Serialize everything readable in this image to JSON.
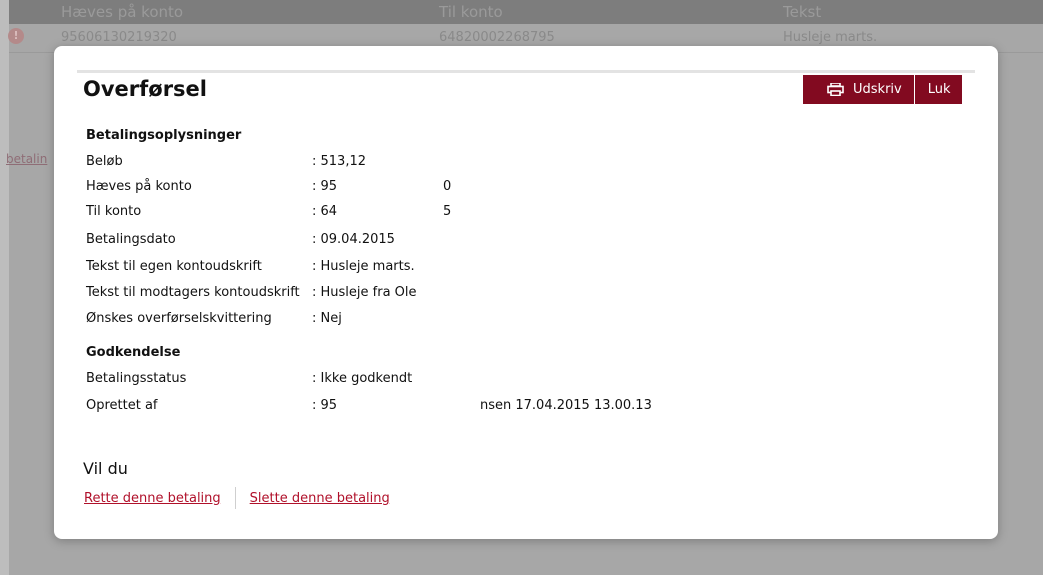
{
  "background": {
    "header_columns": [
      "Hæves på konto",
      "Til konto",
      "Tekst"
    ],
    "row": {
      "from_account": "95606130219320",
      "to_account": "64820002268795",
      "text": "Husleje marts."
    },
    "partial_link": "betalin"
  },
  "modal": {
    "title": "Overførsel",
    "print_label": "Udskriv",
    "close_label": "Luk",
    "payment_section": {
      "title": "Betalingsoplysninger",
      "rows": [
        {
          "label": "Beløb",
          "value": ": 513,12"
        },
        {
          "label": "Hæves på konto",
          "value": ": 95",
          "value_extra": "0"
        },
        {
          "label": "Til konto",
          "value": ": 64",
          "value_extra": "5"
        },
        {
          "label": "Betalingsdato",
          "value": ": 09.04.2015"
        },
        {
          "label": "Tekst til egen kontoudskrift",
          "value": ": Husleje marts."
        },
        {
          "label": "Tekst til modtagers kontoudskrift",
          "value": ": Husleje fra Ole"
        },
        {
          "label": "Ønskes overførselskvittering",
          "value": ": Nej"
        }
      ]
    },
    "approval_section": {
      "title": "Godkendelse",
      "rows": [
        {
          "label": "Betalingsstatus",
          "value": ": Ikke godkendt"
        },
        {
          "label": "Oprettet af",
          "value": ": 95",
          "value_extra": "nsen 17.04.2015 13.00.13"
        }
      ]
    },
    "vil_du": "Vil du",
    "links": {
      "edit": "Rette denne betaling",
      "delete": "Slette denne betaling"
    }
  },
  "colors": {
    "accent": "#820a20",
    "link": "#b0102a"
  }
}
